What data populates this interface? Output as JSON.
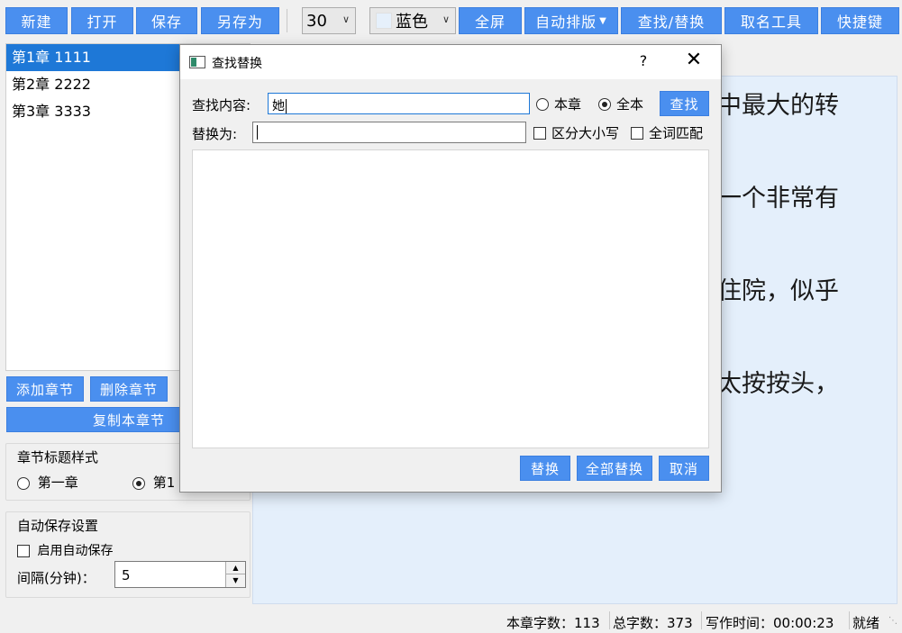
{
  "toolbar": {
    "new": "新建",
    "open": "打开",
    "save": "保存",
    "save_as": "另存为",
    "font_size": "30",
    "color": "蓝色",
    "fullscreen": "全屏",
    "auto_layout": "自动排版",
    "find_replace": "查找/替换",
    "naming_tool": "取名工具",
    "shortcuts": "快捷键"
  },
  "chapters": [
    {
      "label": "第1章 1111"
    },
    {
      "label": "第2章 2222"
    },
    {
      "label": "第3章 3333"
    }
  ],
  "chapter_buttons": {
    "add": "添加章节",
    "delete": "删除章节",
    "copy": "复制本章节"
  },
  "title_style": {
    "title": "章节标题样式",
    "option1": "第一章",
    "option2": "第1"
  },
  "autosave": {
    "title": "自动保存设置",
    "enable": "启用自动保存",
    "interval_label": "间隔(分钟)：",
    "interval_value": "5"
  },
  "editor": {
    "lines": [
      "中最大的转",
      "一个非常有",
      "住院，似乎",
      "太按按头，"
    ]
  },
  "status": {
    "chapter_words": "本章字数：113",
    "total_words": "总字数：373",
    "writing_time": "写作时间：00:00:23",
    "state": "就绪"
  },
  "dialog": {
    "title": "查找替换",
    "help": "?",
    "close": "✕",
    "find_label": "查找内容:",
    "find_value": "她",
    "scope_chapter": "本章",
    "scope_all": "全本",
    "find_button": "查找",
    "replace_label": "替换为:",
    "replace_value": "",
    "case_sensitive": "区分大小写",
    "whole_word": "全词匹配",
    "replace_button": "替换",
    "replace_all_button": "全部替换",
    "cancel_button": "取消"
  },
  "colors": {
    "accent": "#4a8fef",
    "selection": "#1e78d7",
    "editor_bg": "#e4effb"
  }
}
